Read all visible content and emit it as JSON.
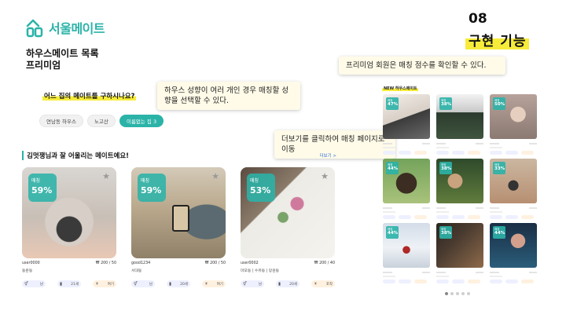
{
  "brand": {
    "name": "서울메이트",
    "color": "#2bb3a8"
  },
  "section": {
    "number": "08",
    "title": "구현 기능"
  },
  "page": {
    "title_line1": "하우스메이트 목록",
    "title_line2": "프리미엄"
  },
  "filter": {
    "question": "어느 집의 메이트를 구하시나요?",
    "chips": [
      "연남동 하우스",
      "노고산",
      "이름없는 집 3"
    ],
    "active_index": 2
  },
  "callouts": {
    "personality": "하우스 성향이 여러 개인 경우 매칭할 성향을 선택할 수 있다.",
    "more": "더보기를 클릭하여 매칭 페이지로 이동",
    "premium": "프리미엄 회원은 매칭 점수를 확인할 수 있다."
  },
  "list": {
    "title": "김멋쟁님과 잘 어울리는 메이트예요!",
    "more_label": "더보기 >",
    "cards": [
      {
        "match_label": "매칭",
        "match_value": "59%",
        "user": "user0000",
        "price": "₩ 200 / 50",
        "place": "동문동",
        "tags": [
          "남",
          "21세",
          "여기"
        ]
      },
      {
        "match_label": "매칭",
        "match_value": "59%",
        "user": "good1234",
        "price": "₩ 200 / 50",
        "place": "서대동",
        "tags": [
          "남",
          "20세",
          "여기"
        ]
      },
      {
        "match_label": "매칭",
        "match_value": "53%",
        "user": "user0002",
        "price": "₩ 200 / 40",
        "place": "마포동 | 수유동 | 망원동",
        "tags": [
          "남",
          "20세",
          "포착"
        ]
      }
    ]
  },
  "mini_panel": {
    "title": "NEW 하우스메이트",
    "cards": [
      {
        "label": "매칭",
        "value": "47%"
      },
      {
        "label": "매칭",
        "value": "38%"
      },
      {
        "label": "매칭",
        "value": "50%"
      },
      {
        "label": "매칭",
        "value": "44%"
      },
      {
        "label": "매칭",
        "value": "38%"
      },
      {
        "label": "매칭",
        "value": "33%"
      },
      {
        "label": "매칭",
        "value": "44%"
      },
      {
        "label": "매칭",
        "value": "38%"
      },
      {
        "label": "매칭",
        "value": "44%"
      }
    ]
  }
}
